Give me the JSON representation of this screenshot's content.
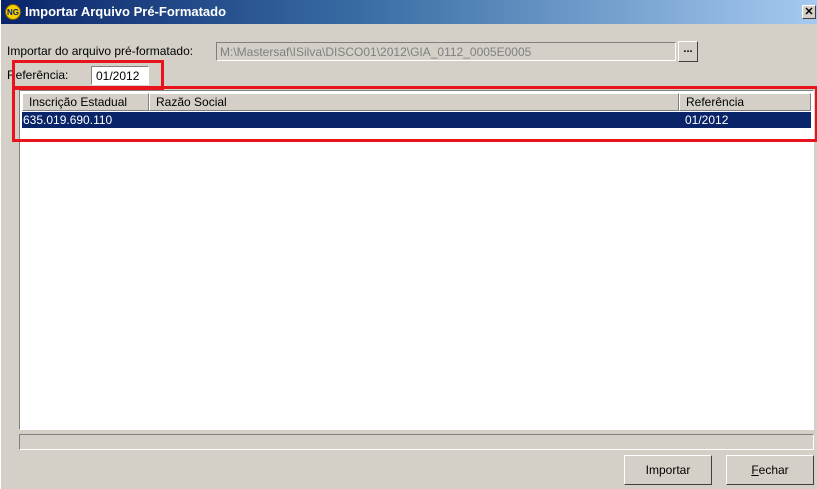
{
  "window": {
    "title": "Importar Arquivo Pré-Formatado",
    "logo_text": "NG",
    "close_glyph": "✕"
  },
  "form": {
    "file_label": "Importar do arquivo pré-formatado:",
    "file_value": "M:\\Mastersaf\\ISilva\\DISCO01\\2012\\GIA_0112_0005E0005",
    "browse_label": "...",
    "ref_label": "Referência:",
    "ref_value": "01/2012"
  },
  "grid": {
    "columns": [
      "Inscrição Estadual",
      "Razão Social",
      "Referência"
    ],
    "rows": [
      {
        "inscricao": "635.019.690.110",
        "razao": "",
        "referencia": "01/2012"
      }
    ]
  },
  "buttons": {
    "import_label": "Importar",
    "close_label": "Fechar"
  },
  "colors": {
    "highlight": "#e8141c",
    "selection": "#0a246a",
    "face": "#d4d0c8"
  }
}
